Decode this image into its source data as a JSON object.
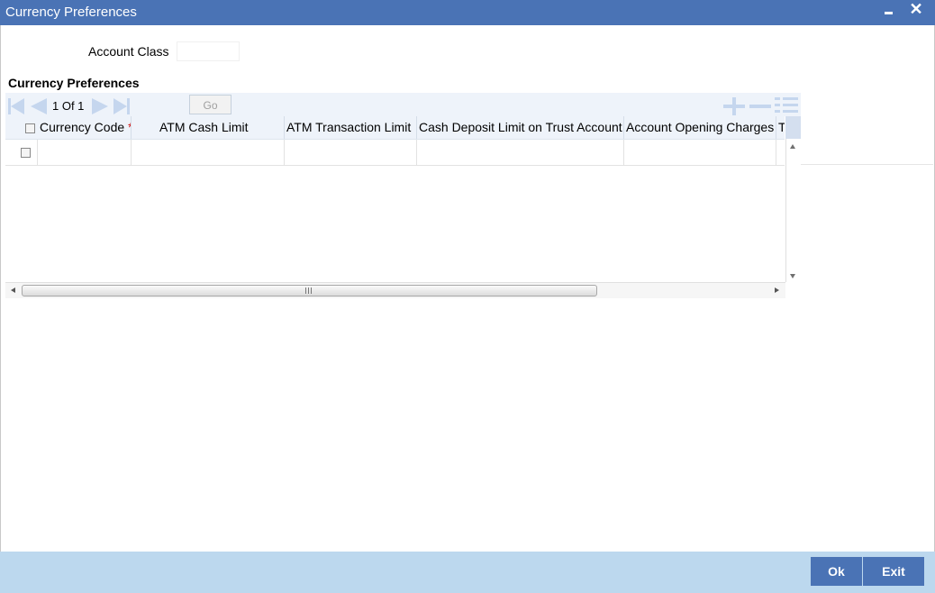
{
  "window": {
    "title": "Currency Preferences",
    "minimize_icon": "minimize-icon",
    "close_icon": "close-icon",
    "close_glyph": "✕"
  },
  "form": {
    "account_class_label": "Account Class",
    "account_class_value": ""
  },
  "section": {
    "title": "Currency Preferences"
  },
  "grid": {
    "pagination": {
      "text": "1 Of 1",
      "page_input_value": "",
      "go_label": "Go"
    },
    "toolbar_icons": [
      "add-row-icon",
      "delete-row-icon",
      "list-view-icon"
    ],
    "columns": [
      {
        "label": "Currency Code",
        "required": true,
        "required_mark": "*"
      },
      {
        "label": "ATM Cash Limit",
        "required": false
      },
      {
        "label": "ATM Transaction Limit",
        "required": false
      },
      {
        "label": "Cash Deposit Limit on Trust Account",
        "required": false
      },
      {
        "label": "Account Opening Charges",
        "required": false
      },
      {
        "label": "T",
        "required": false
      }
    ],
    "rows": [
      {
        "checked": false,
        "cells": [
          "",
          "",
          "",
          "",
          "",
          ""
        ]
      }
    ]
  },
  "footer": {
    "ok_label": "Ok",
    "exit_label": "Exit"
  },
  "colors": {
    "titlebar": "#4a73b5",
    "footer": "#bcd8ee",
    "button": "#4a73b5",
    "grid_header": "#eef3fa",
    "required": "#d00000"
  }
}
